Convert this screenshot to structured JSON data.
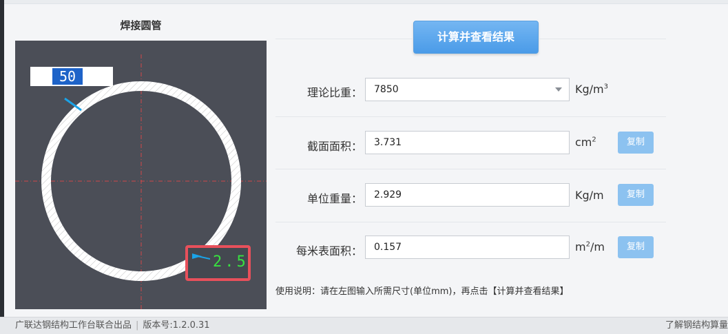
{
  "left_panel": {
    "title": "焊接圆管",
    "outer_diameter_value": "50",
    "thickness_value": "2.5"
  },
  "actions": {
    "calculate_label": "计算并查看结果",
    "copy_label": "复制"
  },
  "rows": [
    {
      "label": "理论比重：",
      "value": "7850",
      "unit_main": "Kg/m",
      "unit_sup": "3",
      "unit_tail": ""
    },
    {
      "label": "截面面积：",
      "value": "3.731",
      "unit_main": "cm",
      "unit_sup": "2",
      "unit_tail": ""
    },
    {
      "label": "单位重量：",
      "value": "2.929",
      "unit_main": "Kg/m",
      "unit_sup": "",
      "unit_tail": ""
    },
    {
      "label": "每米表面积：",
      "value": "0.157",
      "unit_main": "m",
      "unit_sup": "2",
      "unit_tail": "/m"
    }
  ],
  "note": "使用说明：请在左图输入所需尺寸(单位mm)，再点击【计算并查看结果】",
  "footer": {
    "left_text": "广联达钢结构工作台联合出品",
    "separator": "|",
    "version": "版本号:1.2.0.31",
    "right_text": "了解钢结构算量"
  },
  "colors": {
    "canvas_bg": "#4b4e57",
    "accent_blue": "#4a9be8",
    "highlight_red": "#e8505b",
    "dimension_green": "#38e040"
  }
}
